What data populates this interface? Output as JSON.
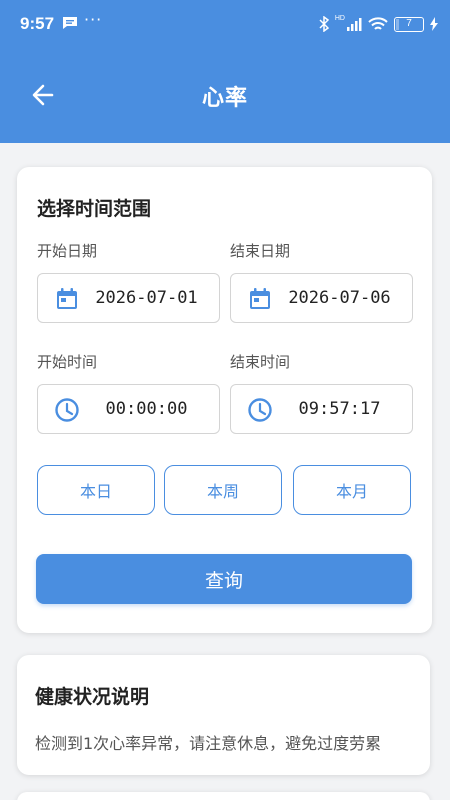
{
  "status_bar": {
    "time": "9:57",
    "more": "···",
    "network": "HD",
    "battery": "7"
  },
  "header": {
    "title": "心率"
  },
  "filter": {
    "title": "选择时间范围",
    "start_date_label": "开始日期",
    "start_date": "2026-07-01",
    "end_date_label": "结束日期",
    "end_date": "2026-07-06",
    "start_time_label": "开始时间",
    "start_time": "00:00:00",
    "end_time_label": "结束时间",
    "end_time": "09:57:17",
    "quick_ranges": [
      "本日",
      "本周",
      "本月"
    ],
    "query_label": "查询"
  },
  "health": {
    "title": "健康状况说明",
    "message": "检测到1次心率异常，请注意休息，避免过度劳累"
  },
  "colors": {
    "primary": "#4a8ee0",
    "background": "#f2f3f5"
  },
  "icons": {
    "back": "arrow-left-icon",
    "date": "calendar-icon",
    "time": "clock-icon"
  }
}
